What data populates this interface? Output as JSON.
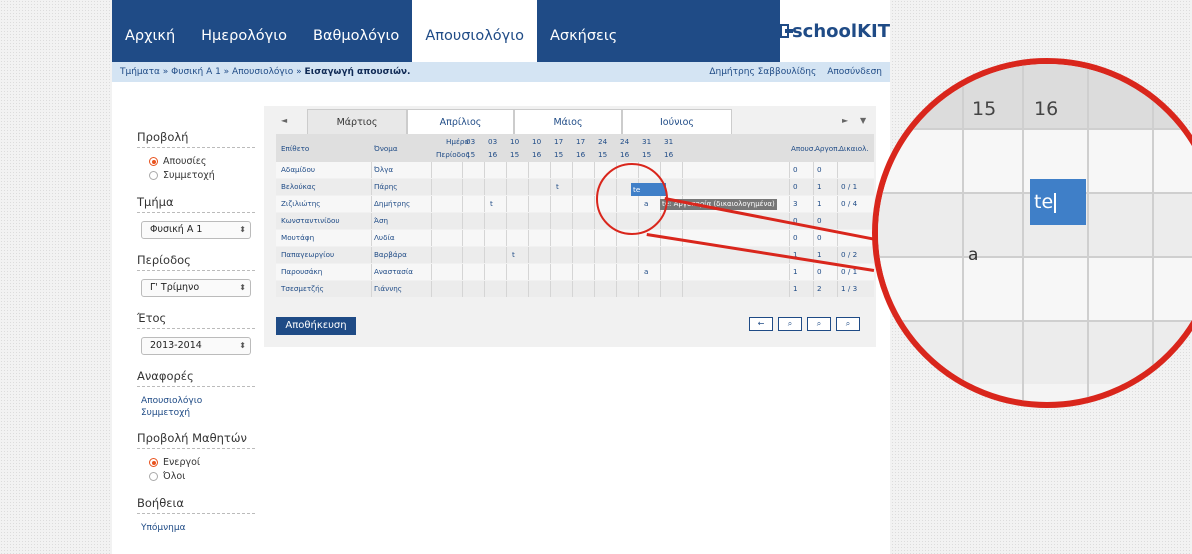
{
  "nav": {
    "items": [
      "Αρχική",
      "Ημερολόγιο",
      "Βαθμολόγιο",
      "Απουσιολόγιο",
      "Ασκήσεις"
    ],
    "active_index": 3,
    "logo_text": "schoolKIT"
  },
  "breadcrumb": {
    "path": "Τμήματα » Φυσική Α 1 » Απουσιολόγιο »",
    "current": "Εισαγωγή απουσιών.",
    "user": "Δημήτρης Σαββουλίδης",
    "logout": "Αποσύνδεση"
  },
  "sidebar": {
    "view": {
      "title": "Προβολή",
      "options": [
        "Απουσίες",
        "Συμμετοχή"
      ],
      "selected": 0
    },
    "class": {
      "title": "Τμήμα",
      "value": "Φυσική Α 1"
    },
    "period": {
      "title": "Περίοδος",
      "value": "Γ' Τρίμηνο"
    },
    "year": {
      "title": "Έτος",
      "value": "2013-2014"
    },
    "reports": {
      "title": "Αναφορές",
      "links": [
        "Απουσιολόγιο",
        "Συμμετοχή"
      ]
    },
    "students_view": {
      "title": "Προβολή Μαθητών",
      "options": [
        "Ενεργοί",
        "Όλοι"
      ],
      "selected": 0
    },
    "help": {
      "title": "Βοήθεια",
      "link": "Υπόμνημα"
    }
  },
  "tabs": {
    "prev": "◄",
    "next": "►",
    "menu": "▼",
    "months": [
      "Μάρτιος",
      "Απρίλιος",
      "Μάιος",
      "Ιούνιος"
    ],
    "active_index": 0
  },
  "grid": {
    "col_surname": "Επίθετο",
    "col_name": "Όνομα",
    "label_day": "Ημέρα",
    "label_period": "Περίοδος",
    "days": [
      "03",
      "03",
      "10",
      "10",
      "17",
      "17",
      "24",
      "24",
      "31",
      "31"
    ],
    "periods": [
      "15",
      "16",
      "15",
      "16",
      "15",
      "16",
      "15",
      "16",
      "15",
      "16"
    ],
    "col_absences": "Απουσ.",
    "col_late": "Αργοπ.",
    "col_justified": "Δικαιολ.",
    "rows": [
      {
        "surname": "Αδαμίδου",
        "name": "Όλγα",
        "marks": {},
        "absences": "0",
        "late": "0",
        "justified": ""
      },
      {
        "surname": "Βελούκας",
        "name": "Πάρης",
        "marks": {
          "4": "t"
        },
        "absences": "0",
        "late": "1",
        "justified": "0 / 1"
      },
      {
        "surname": "Ζιζιλιώτης",
        "name": "Δημήτρης",
        "marks": {
          "1": "t",
          "8": "a"
        },
        "absences": "3",
        "late": "1",
        "justified": "0 / 4"
      },
      {
        "surname": "Κωνσταντινίδου",
        "name": "Άση",
        "marks": {},
        "absences": "0",
        "late": "0",
        "justified": ""
      },
      {
        "surname": "Μουτάφη",
        "name": "Λυδία",
        "marks": {},
        "absences": "0",
        "late": "0",
        "justified": ""
      },
      {
        "surname": "Παπαγεωργίου",
        "name": "Βαρβάρα",
        "marks": {
          "2": "t"
        },
        "absences": "1",
        "late": "1",
        "justified": "0 / 2"
      },
      {
        "surname": "Παρουσάκη",
        "name": "Αναστασία",
        "marks": {
          "8": "a"
        },
        "absences": "1",
        "late": "0",
        "justified": "0 / 1"
      },
      {
        "surname": "Τσεσμετζής",
        "name": "Γιάννης",
        "marks": {},
        "absences": "1",
        "late": "2",
        "justified": "1 / 3"
      }
    ],
    "editing_value": "te",
    "tooltip": "te: Αργοπορία (δικαιολογημένα)"
  },
  "actions": {
    "save": "Αποθήκευση",
    "icons": [
      "←",
      "⌕",
      "⌕",
      "⌕"
    ]
  },
  "zoom": {
    "col_a": "15",
    "col_b": "16",
    "value": "te",
    "mark": "a"
  },
  "colors": {
    "nav_blue": "#1f4b86",
    "accent_orange": "#e8531f",
    "highlight_red": "#d9261c",
    "selected_cell": "#3f7fc8"
  }
}
